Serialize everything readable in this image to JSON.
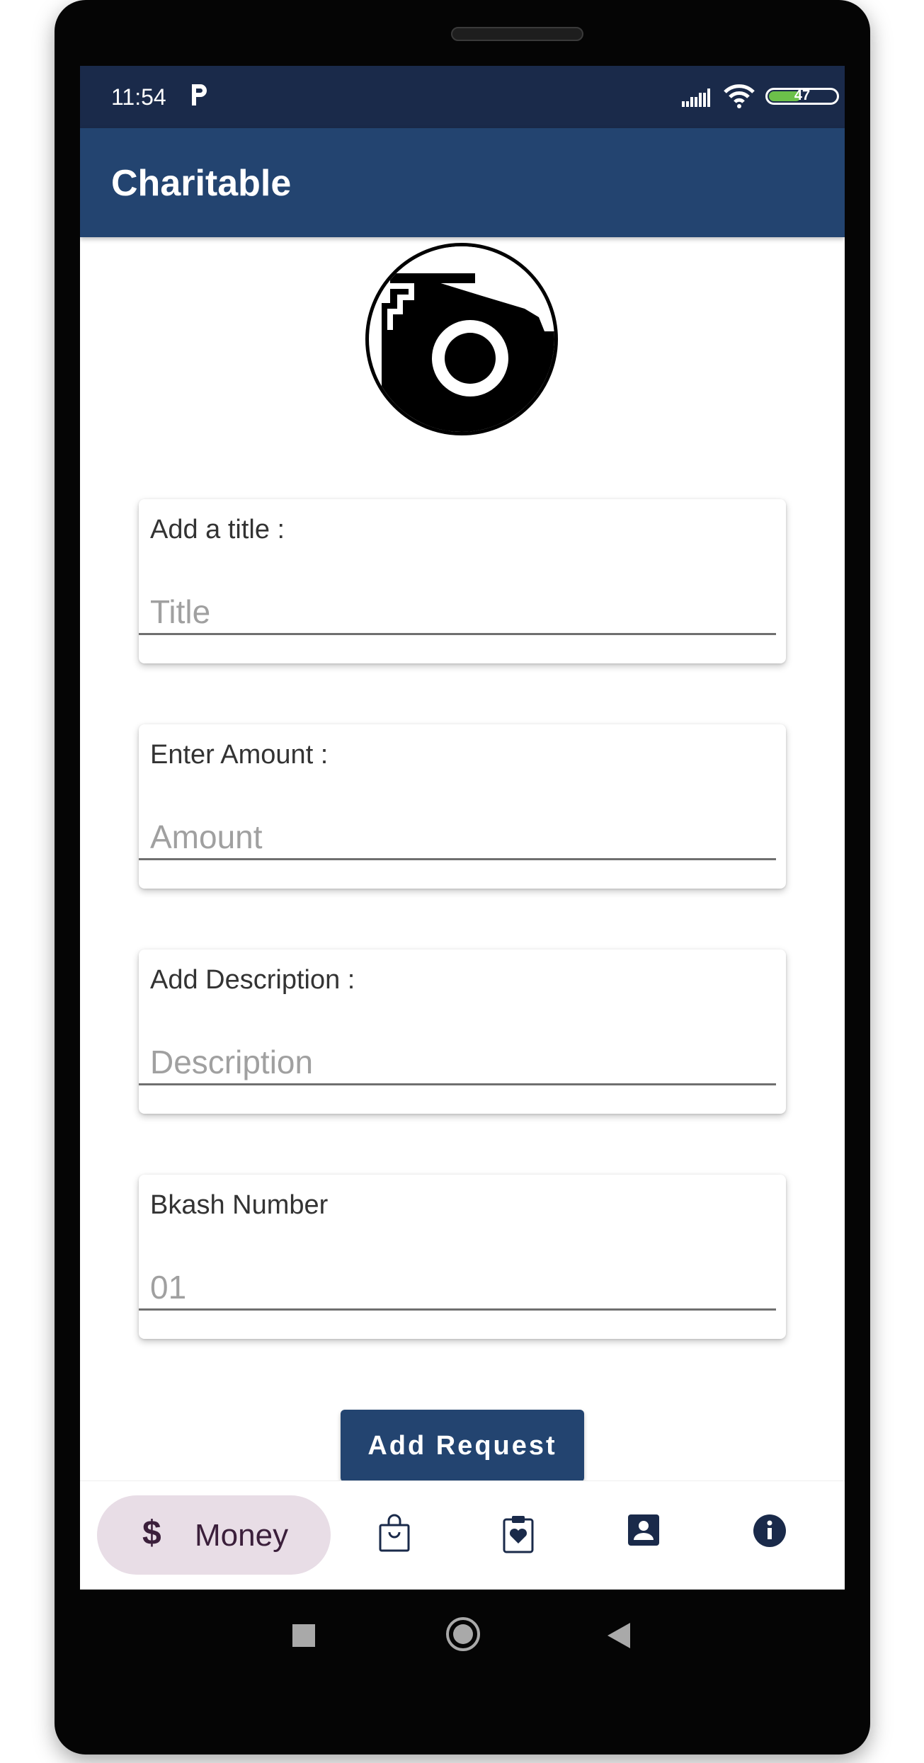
{
  "status": {
    "time": "11:54",
    "battery": "47"
  },
  "appbar": {
    "title": "Charitable"
  },
  "form": {
    "title": {
      "label": "Add a title :",
      "placeholder": "Title"
    },
    "amount": {
      "label": "Enter Amount :",
      "placeholder": "Amount"
    },
    "description": {
      "label": "Add Description :",
      "placeholder": "Description"
    },
    "bkash": {
      "label": "Bkash Number",
      "placeholder": "01"
    }
  },
  "submit_label": "Add Request",
  "bottom_nav": {
    "active_label": "Money",
    "items": [
      "money-icon",
      "shopping-bag-icon",
      "clipboard-heart-icon",
      "contact-icon",
      "info-icon"
    ]
  },
  "colors": {
    "primary": "#234470",
    "status_bar": "#1a2a4a",
    "nav_active_bg": "#e8dde6"
  }
}
